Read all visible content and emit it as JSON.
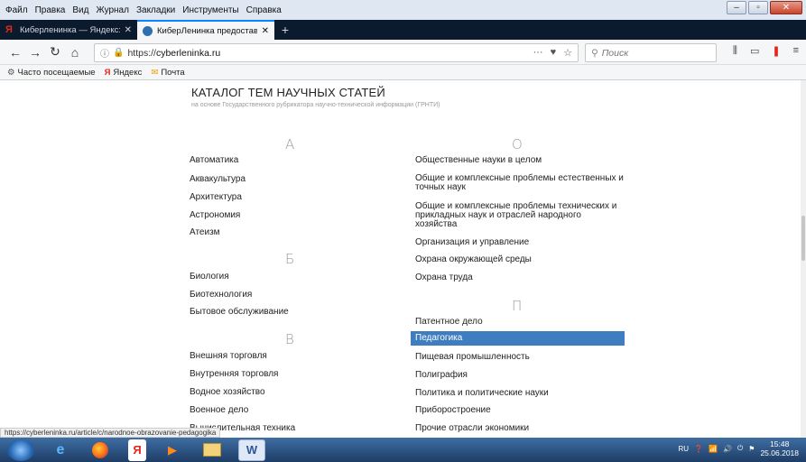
{
  "menu": [
    "Файл",
    "Правка",
    "Вид",
    "Журнал",
    "Закладки",
    "Инструменты",
    "Справка"
  ],
  "tabs": [
    {
      "title": "Киберленинка — Яндекс: нашл",
      "close": "✕",
      "icon": "yandex-icon",
      "active": false
    },
    {
      "title": "КиберЛенинка предоставляет",
      "close": "✕",
      "icon": "cyberleninka-icon",
      "active": true
    }
  ],
  "new_tab": "+",
  "url": {
    "scheme": "https://",
    "host": "cyberleninka.ru"
  },
  "url_right": [
    "···",
    "♥",
    "☆"
  ],
  "search_placeholder": "Поиск",
  "bookmarks": [
    "Часто посещаемые",
    "Яндекс",
    "Почта"
  ],
  "page": {
    "title": "КАТАЛОГ ТЕМ НАУЧНЫХ СТАТЕЙ",
    "subtitle": "на основе Государственного рубрикатора научно-технической информации (ГРНТИ)"
  },
  "left": {
    "A": {
      "letter": "А",
      "items": [
        "Автоматика",
        "Аквакультура",
        "Архитектура",
        "Астрономия",
        "Атеизм"
      ]
    },
    "B": {
      "letter": "Б",
      "items": [
        "Биология",
        "Биотехнология",
        "Бытовое обслуживание"
      ]
    },
    "V": {
      "letter": "В",
      "items": [
        "Внешняя торговля",
        "Внутренняя торговля",
        "Водное хозяйство",
        "Военное дело",
        "Вычислительная техника"
      ]
    }
  },
  "right": {
    "O": {
      "letter": "О",
      "items": [
        "Общественные науки в целом",
        "Общие и комплексные проблемы естественных и точных наук",
        "Общие и комплексные проблемы технических и прикладных наук и отраслей народного хозяйства",
        "Организация и управление",
        "Охрана окружающей среды",
        "Охрана труда"
      ]
    },
    "P": {
      "letter": "П",
      "items": [
        "Патентное дело",
        "Педагогика",
        "Пищевая промышленность",
        "Полиграфия",
        "Политика и политические науки",
        "Приборостроение",
        "Прочие отрасли экономики"
      ]
    }
  },
  "status_url": "https://cyberleninka.ru/article/c/narodnoe-obrazovanie-pedagogika",
  "tray": {
    "lang": "RU",
    "time": "15:48",
    "date": "25.06.2018"
  }
}
